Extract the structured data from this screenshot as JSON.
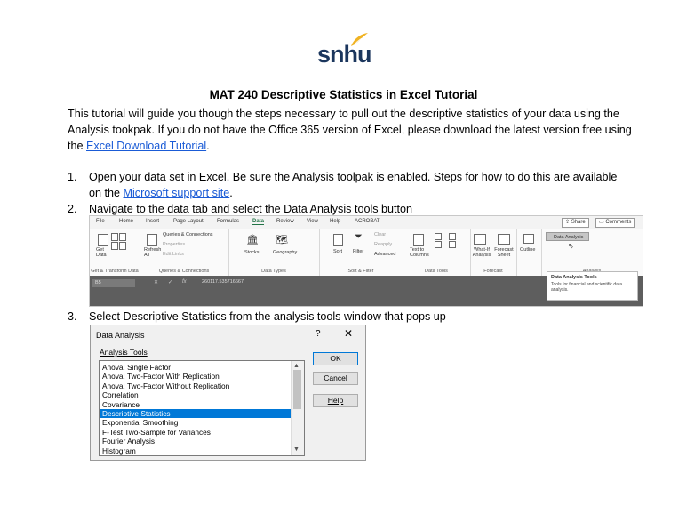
{
  "logo": {
    "text": "snhu"
  },
  "title": "MAT 240 Descriptive Statistics in Excel Tutorial",
  "intro": {
    "text_before": "This tutorial will guide you though the steps necessary to pull out the descriptive statistics of your data using the Analysis tookpak. If you do not have the Office 365 version of Excel, please download the latest version free using the ",
    "link": "Excel Download Tutorial",
    "text_after": "."
  },
  "steps": [
    {
      "num": "1.",
      "text": "Open your data set in Excel. Be sure the Analysis toolpak is enabled. Steps for how to do this are available on the ",
      "link": "Microsoft support site",
      "after": "."
    },
    {
      "num": "2.",
      "text": "Navigate to the data tab and select the Data Analysis tools button"
    },
    {
      "num": "3.",
      "text": "Select Descriptive Statistics from the analysis tools window that pops up"
    }
  ],
  "ribbon": {
    "tabs": [
      "File",
      "Home",
      "Insert",
      "Page Layout",
      "Formulas",
      "Data",
      "Review",
      "View",
      "Help",
      "ACROBAT"
    ],
    "active_tab": "Data",
    "share": "Share",
    "comments": "Comments",
    "groups": {
      "get": "Get & Transform Data",
      "queries": "Queries & Connections",
      "types": "Data Types",
      "sortfilter": "Sort & Filter",
      "tools": "Data Tools",
      "forecast": "Forecast",
      "analysis": "Analysis"
    },
    "items": {
      "get_data": "Get Data",
      "refresh": "Refresh All",
      "qc": "Queries & Connections",
      "properties": "Properties",
      "edit_links": "Edit Links",
      "stocks": "Stocks",
      "geography": "Geography",
      "sort": "Sort",
      "filter": "Filter",
      "clear": "Clear",
      "reapply": "Reapply",
      "advanced": "Advanced",
      "text_to_columns": "Text to Columns",
      "whatif": "What-If Analysis",
      "forecast_sheet": "Forecast Sheet",
      "outline": "Outline",
      "data_analysis": "Data Analysis"
    },
    "namebox": "B5",
    "formula_value": "260117.535716667",
    "tooltip_title": "Data Analysis Tools",
    "tooltip_text": "Tools for financial and scientific data analysis."
  },
  "dialog": {
    "title": "Data Analysis",
    "help_glyph": "?",
    "close_glyph": "✕",
    "label": "Analysis Tools",
    "items": [
      "Anova: Single Factor",
      "Anova: Two-Factor With Replication",
      "Anova: Two-Factor Without Replication",
      "Correlation",
      "Covariance",
      "Descriptive Statistics",
      "Exponential Smoothing",
      "F-Test Two-Sample for Variances",
      "Fourier Analysis",
      "Histogram"
    ],
    "selected_index": 5,
    "ok": "OK",
    "cancel": "Cancel",
    "help": "Help"
  }
}
